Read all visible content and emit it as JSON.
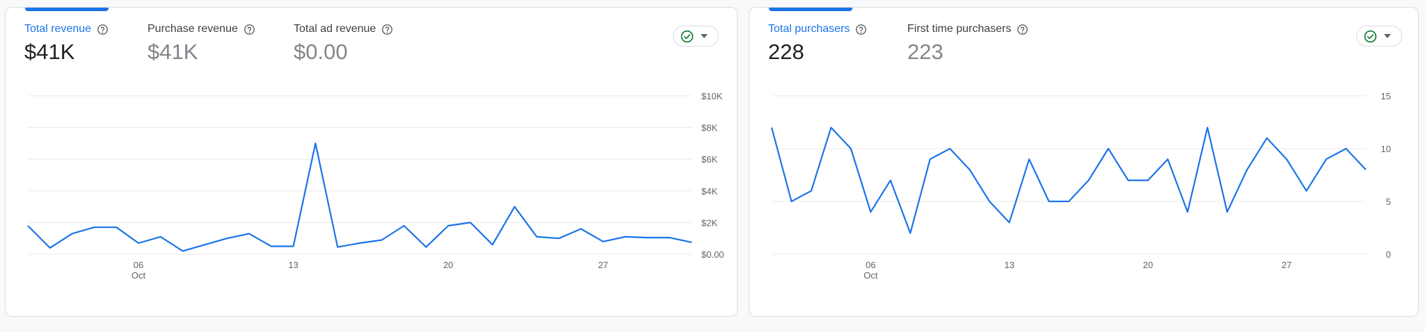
{
  "cards": [
    {
      "metrics": [
        {
          "label": "Total revenue",
          "value": "$41K",
          "active": true
        },
        {
          "label": "Purchase revenue",
          "value": "$41K",
          "active": false
        },
        {
          "label": "Total ad revenue",
          "value": "$0.00",
          "active": false
        }
      ]
    },
    {
      "metrics": [
        {
          "label": "Total purchasers",
          "value": "228",
          "active": true
        },
        {
          "label": "First time purchasers",
          "value": "223",
          "active": false
        }
      ]
    }
  ],
  "colors": {
    "accent": "#1a73e8",
    "success": "#188038",
    "grid": "#e8eaed",
    "text_muted": "#5f6368"
  },
  "icons": {
    "help": "help-circle-icon",
    "compare": "check-circle-icon",
    "dropdown": "caret-down-icon"
  },
  "chart_data": [
    {
      "type": "line",
      "x": [
        "Oct 1",
        "Oct 2",
        "Oct 3",
        "Oct 4",
        "Oct 5",
        "Oct 6",
        "Oct 7",
        "Oct 8",
        "Oct 9",
        "Oct 10",
        "Oct 11",
        "Oct 12",
        "Oct 13",
        "Oct 14",
        "Oct 15",
        "Oct 16",
        "Oct 17",
        "Oct 18",
        "Oct 19",
        "Oct 20",
        "Oct 21",
        "Oct 22",
        "Oct 23",
        "Oct 24",
        "Oct 25",
        "Oct 26",
        "Oct 27",
        "Oct 28",
        "Oct 29",
        "Oct 30",
        "Oct 31"
      ],
      "series": [
        {
          "values": [
            1800,
            400,
            1300,
            1700,
            1700,
            700,
            1100,
            200,
            600,
            1000,
            1300,
            500,
            500,
            7000,
            450,
            700,
            900,
            1800,
            450,
            1800,
            2000,
            600,
            3000,
            1100,
            1000,
            1600,
            800,
            1100,
            1050,
            1050,
            750
          ]
        }
      ],
      "x_ticks": [
        {
          "index": 5,
          "label": "06",
          "sublabel": "Oct"
        },
        {
          "index": 12,
          "label": "13"
        },
        {
          "index": 19,
          "label": "20"
        },
        {
          "index": 26,
          "label": "27"
        }
      ],
      "y_ticks": [
        "$0.00",
        "$2K",
        "$4K",
        "$6K",
        "$8K",
        "$10K"
      ],
      "ylim": [
        0,
        10000
      ],
      "grid": true
    },
    {
      "type": "line",
      "x": [
        "Oct 1",
        "Oct 2",
        "Oct 3",
        "Oct 4",
        "Oct 5",
        "Oct 6",
        "Oct 7",
        "Oct 8",
        "Oct 9",
        "Oct 10",
        "Oct 11",
        "Oct 12",
        "Oct 13",
        "Oct 14",
        "Oct 15",
        "Oct 16",
        "Oct 17",
        "Oct 18",
        "Oct 19",
        "Oct 20",
        "Oct 21",
        "Oct 22",
        "Oct 23",
        "Oct 24",
        "Oct 25",
        "Oct 26",
        "Oct 27",
        "Oct 28",
        "Oct 29",
        "Oct 30",
        "Oct 31"
      ],
      "series": [
        {
          "values": [
            12,
            5,
            6,
            12,
            10,
            4,
            7,
            2,
            9,
            10,
            8,
            5,
            3,
            9,
            5,
            5,
            7,
            10,
            7,
            7,
            9,
            4,
            12,
            4,
            8,
            11,
            9,
            6,
            9,
            10,
            8
          ]
        }
      ],
      "x_ticks": [
        {
          "index": 5,
          "label": "06",
          "sublabel": "Oct"
        },
        {
          "index": 12,
          "label": "13"
        },
        {
          "index": 19,
          "label": "20"
        },
        {
          "index": 26,
          "label": "27"
        }
      ],
      "y_ticks": [
        "0",
        "5",
        "10",
        "15"
      ],
      "ylim": [
        0,
        15
      ],
      "grid": true
    }
  ]
}
